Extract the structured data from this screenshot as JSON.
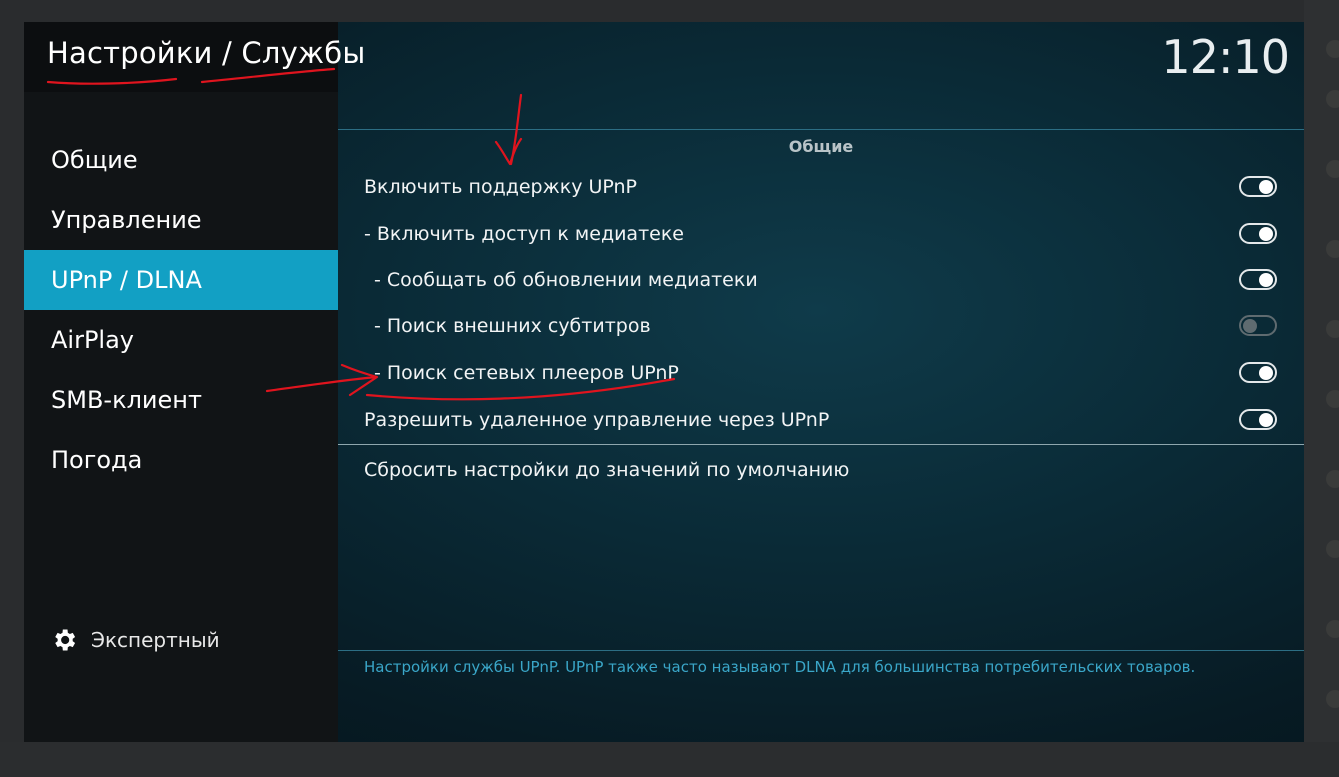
{
  "header": {
    "title": "Настройки / Службы",
    "clock": "12:10"
  },
  "sidebar": {
    "items": [
      {
        "label": "Общие",
        "active": false
      },
      {
        "label": "Управление",
        "active": false
      },
      {
        "label": "UPnP / DLNA",
        "active": true
      },
      {
        "label": "AirPlay",
        "active": false
      },
      {
        "label": "SMB-клиент",
        "active": false
      },
      {
        "label": "Погода",
        "active": false
      }
    ],
    "settings_level": {
      "label": "Экспертный",
      "icon": "gear-icon"
    }
  },
  "main": {
    "section_title": "Общие",
    "settings": [
      {
        "label": "Включить поддержку UPnP",
        "enabled": true
      },
      {
        "label": "- Включить доступ к медиатеке",
        "enabled": true
      },
      {
        "label": "- Сообщать об обновлении медиатеки",
        "enabled": true
      },
      {
        "label": "- Поиск внешних субтитров",
        "enabled": false
      },
      {
        "label": "- Поиск сетевых плееров UPnP",
        "enabled": true
      },
      {
        "label": "Разрешить удаленное управление через UPnP",
        "enabled": true
      }
    ],
    "reset_label": "Сбросить настройки до значений по умолчанию",
    "description": "Настройки службы UPnP. UPnP также часто называют DLNA для большинства потребительских товаров."
  },
  "colors": {
    "accent": "#12a0c4",
    "description_text": "#3aa6c8",
    "annotation": "#e0141e"
  }
}
